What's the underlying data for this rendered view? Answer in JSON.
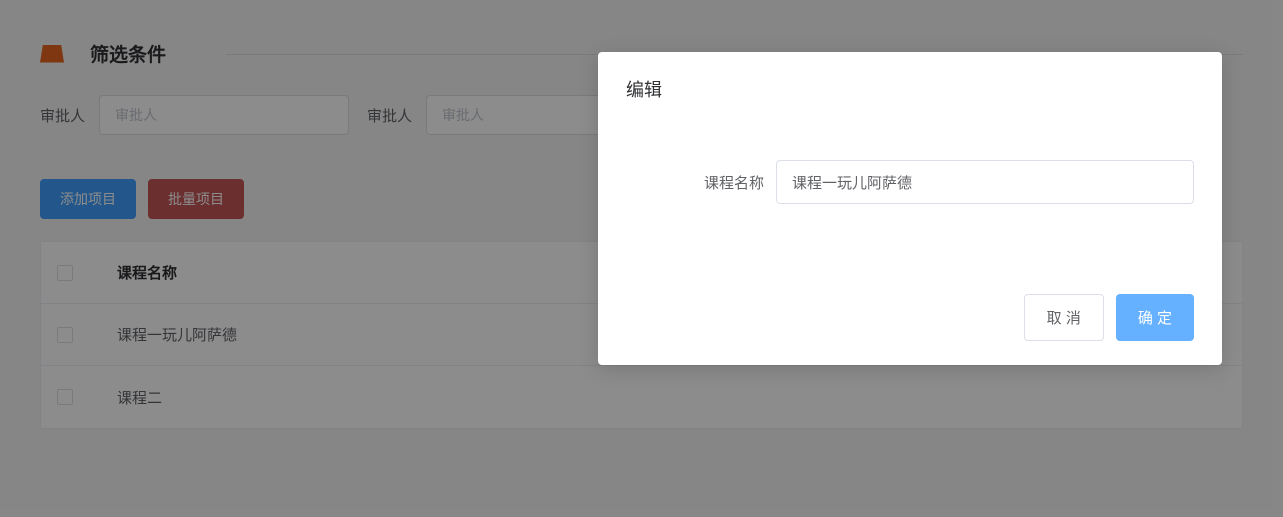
{
  "filter": {
    "title": "筛选条件",
    "approver1": {
      "label": "审批人",
      "placeholder": "审批人",
      "value": ""
    },
    "approver2": {
      "label": "审批人",
      "placeholder": "审批人",
      "value": ""
    }
  },
  "actions": {
    "add_label": "添加项目",
    "batch_label": "批量项目"
  },
  "table": {
    "header": {
      "course_name": "课程名称"
    },
    "rows": [
      {
        "course_name": "课程一玩儿阿萨德"
      },
      {
        "course_name": "课程二"
      }
    ]
  },
  "dialog": {
    "title": "编辑",
    "form": {
      "course_name_label": "课程名称",
      "course_name_value": "课程一玩儿阿萨德"
    },
    "cancel_label": "取 消",
    "confirm_label": "确 定"
  }
}
